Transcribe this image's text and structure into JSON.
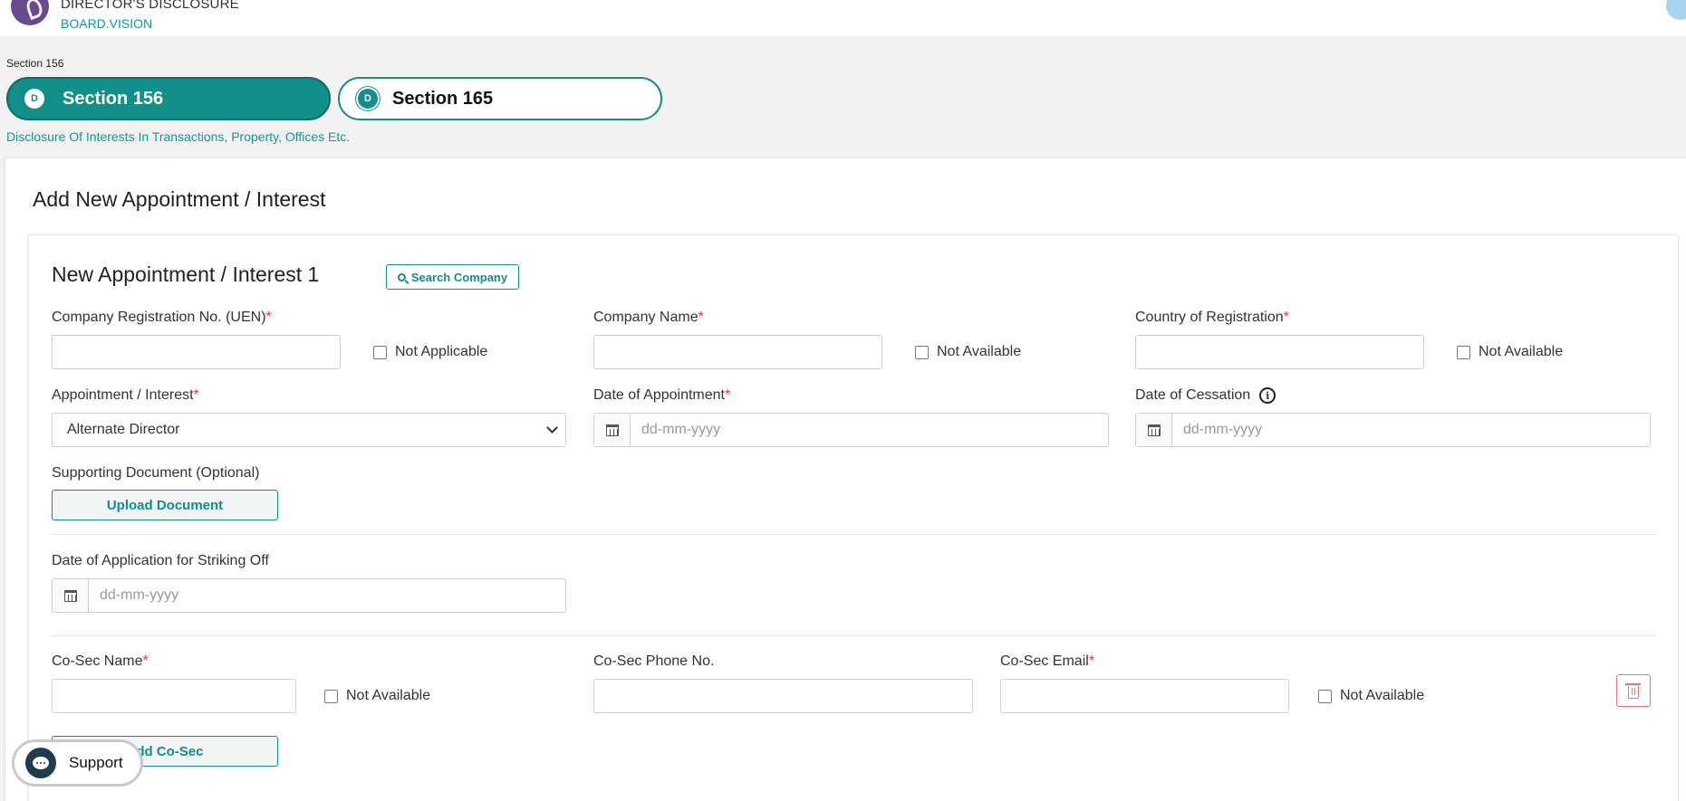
{
  "header": {
    "title": "DIRECTOR'S DISCLOSURE",
    "subtitle": "BOARD.VISION",
    "logo_icon": "board-vision-logo",
    "avatar_icon": "user-avatar-icon"
  },
  "sections": {
    "label": "Section 156",
    "tabs": [
      {
        "badge": "D",
        "label": "Section 156",
        "active": true
      },
      {
        "badge": "D",
        "label": "Section 165",
        "active": false
      }
    ],
    "description": "Disclosure Of Interests In Transactions, Property, Offices Etc."
  },
  "form": {
    "title": "Add New Appointment / Interest",
    "entry": {
      "title": "New Appointment / Interest 1",
      "search_company_label": "Search Company",
      "uen": {
        "label": "Company Registration No. (UEN)",
        "required_mark": "*",
        "value": "",
        "checkbox_label": "Not Applicable",
        "checked": false
      },
      "company_name": {
        "label": "Company Name",
        "required_mark": "*",
        "value": "",
        "checkbox_label": "Not Available",
        "checked": false
      },
      "country": {
        "label": "Country of Registration",
        "required_mark": "*",
        "value": "",
        "checkbox_label": "Not Available",
        "checked": false
      },
      "appointment": {
        "label": "Appointment / Interest",
        "required_mark": "*",
        "selected": "Alternate Director"
      },
      "date_of_appointment": {
        "label": "Date of Appointment",
        "required_mark": "*",
        "placeholder": "dd-mm-yyyy"
      },
      "date_of_cessation": {
        "label": "Date of Cessation",
        "info_icon": "i",
        "placeholder": "dd-mm-yyyy"
      },
      "supporting_doc": {
        "label": "Supporting Document (Optional)",
        "button": "Upload Document"
      },
      "striking_off": {
        "label": "Date of Application for Striking Off",
        "placeholder": "dd-mm-yyyy"
      },
      "cosec_name": {
        "label": "Co-Sec Name",
        "required_mark": "*",
        "value": "",
        "checkbox_label": "Not Available",
        "checked": false
      },
      "cosec_phone": {
        "label": "Co-Sec Phone No.",
        "value": ""
      },
      "cosec_email": {
        "label": "Co-Sec Email",
        "required_mark": "*",
        "value": "",
        "checkbox_label": "Not Available",
        "checked": false
      },
      "add_cosec_button": "Add Co-Sec"
    }
  },
  "support": {
    "label": "Support"
  },
  "colors": {
    "accent": "#138f89",
    "required": "#e53935",
    "danger": "#e57373"
  }
}
